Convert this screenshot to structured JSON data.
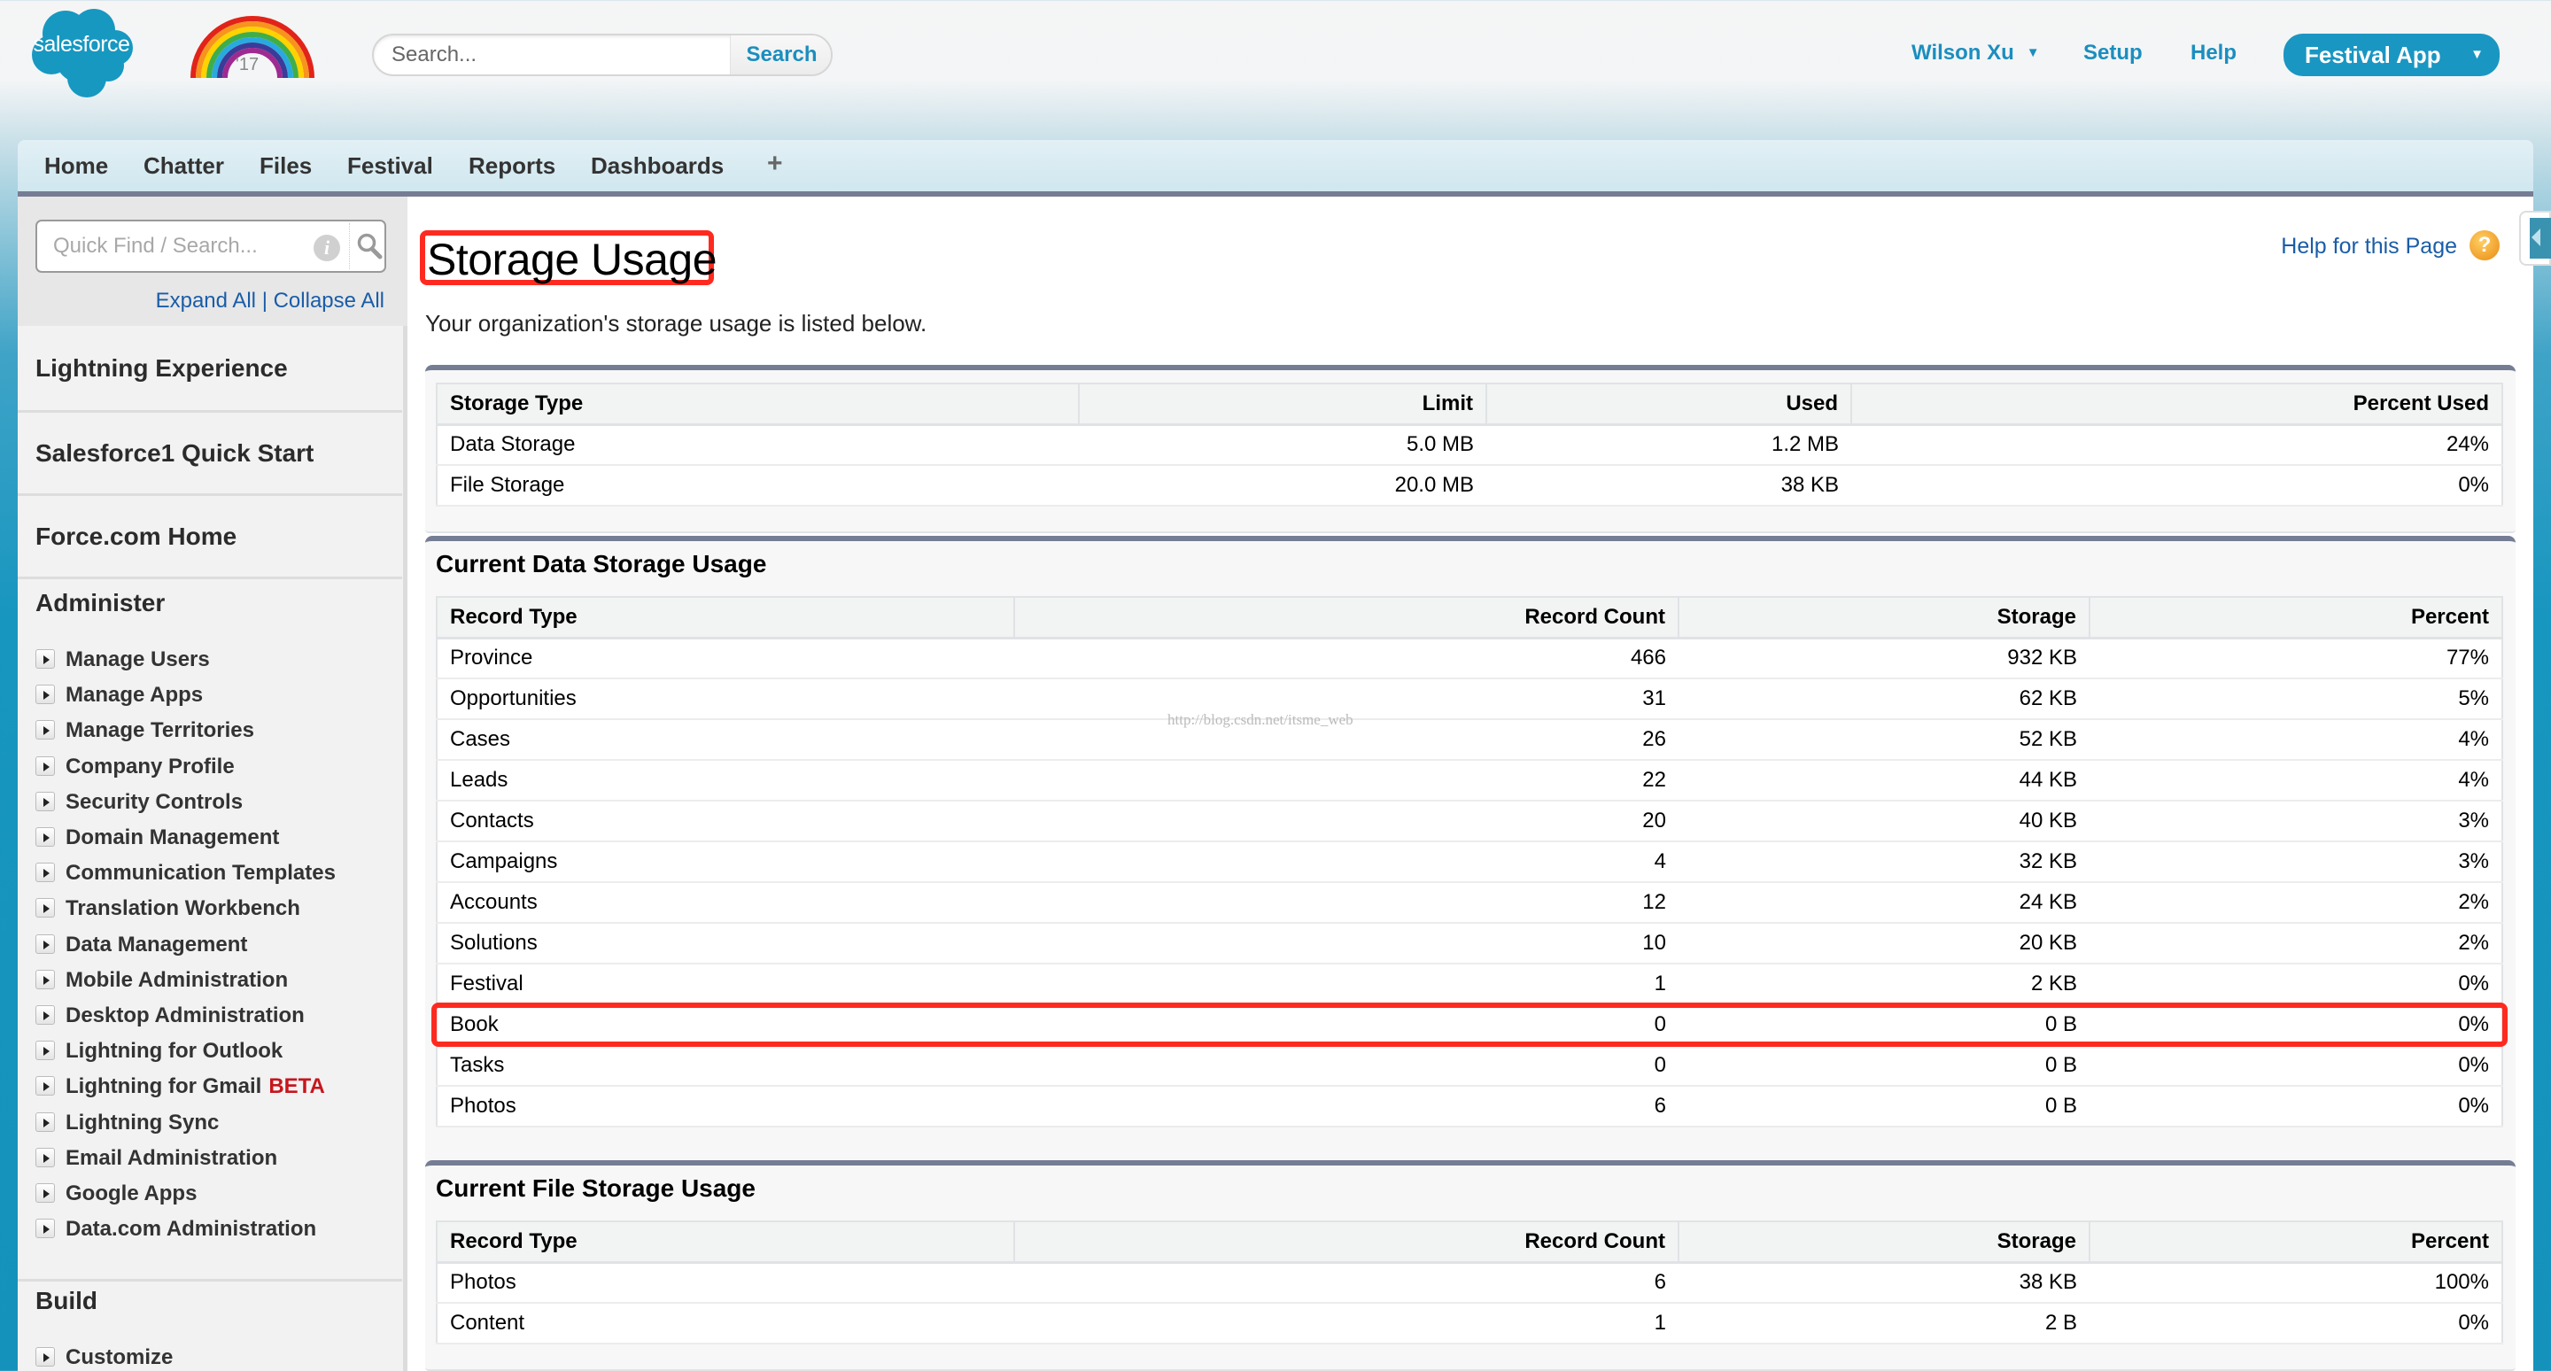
{
  "header": {
    "brand": "salesforce",
    "badge_year": "'17",
    "search": {
      "placeholder": "Search...",
      "button_label": "Search"
    },
    "user_menu_label": "Wilson Xu",
    "setup_label": "Setup",
    "help_label": "Help",
    "app_menu_label": "Festival App",
    "accent_color": "#1a96c2"
  },
  "tabs": [
    "Home",
    "Chatter",
    "Files",
    "Festival",
    "Reports",
    "Dashboards"
  ],
  "tab_add_icon": "+",
  "sidebar": {
    "quick_find_placeholder": "Quick Find / Search...",
    "expand_all": "Expand All",
    "separator": "|",
    "collapse_all": "Collapse All",
    "sections": [
      "Lightning Experience",
      "Salesforce1 Quick Start",
      "Force.com Home"
    ],
    "administer_title": "Administer",
    "administer_items": [
      "Manage Users",
      "Manage Apps",
      "Manage Territories",
      "Company Profile",
      "Security Controls",
      "Domain Management",
      "Communication Templates",
      "Translation Workbench",
      "Data Management",
      "Mobile Administration",
      "Desktop Administration",
      "Lightning for Outlook",
      "Lightning for Gmail",
      "Lightning Sync",
      "Email Administration",
      "Google Apps",
      "Data.com Administration"
    ],
    "beta_label": "BETA",
    "build_title": "Build",
    "build_items": [
      "Customize"
    ]
  },
  "main": {
    "title": "Storage Usage",
    "description": "Your organization's storage usage is listed below.",
    "help_link": "Help for this Page",
    "watermark": "http://blog.csdn.net/itsme_web",
    "summary_table": {
      "headers": [
        "Storage Type",
        "Limit",
        "Used",
        "Percent Used"
      ],
      "rows": [
        [
          "Data Storage",
          "5.0 MB",
          "1.2 MB",
          "24%"
        ],
        [
          "File Storage",
          "20.0 MB",
          "38 KB",
          "0%"
        ]
      ]
    },
    "data_storage": {
      "title": "Current Data Storage Usage",
      "headers": [
        "Record Type",
        "Record Count",
        "Storage",
        "Percent"
      ],
      "rows": [
        [
          "Province",
          "466",
          "932 KB",
          "77%"
        ],
        [
          "Opportunities",
          "31",
          "62 KB",
          "5%"
        ],
        [
          "Cases",
          "26",
          "52 KB",
          "4%"
        ],
        [
          "Leads",
          "22",
          "44 KB",
          "4%"
        ],
        [
          "Contacts",
          "20",
          "40 KB",
          "3%"
        ],
        [
          "Campaigns",
          "4",
          "32 KB",
          "3%"
        ],
        [
          "Accounts",
          "12",
          "24 KB",
          "2%"
        ],
        [
          "Solutions",
          "10",
          "20 KB",
          "2%"
        ],
        [
          "Festival",
          "1",
          "2 KB",
          "0%"
        ],
        [
          "Book",
          "0",
          "0 B",
          "0%"
        ],
        [
          "Tasks",
          "0",
          "0 B",
          "0%"
        ],
        [
          "Photos",
          "6",
          "0 B",
          "0%"
        ]
      ],
      "highlighted_row": "Book"
    },
    "file_storage": {
      "title": "Current File Storage Usage",
      "headers": [
        "Record Type",
        "Record Count",
        "Storage",
        "Percent"
      ],
      "rows": [
        [
          "Photos",
          "6",
          "38 KB",
          "100%"
        ],
        [
          "Content",
          "1",
          "2 B",
          "0%"
        ]
      ]
    }
  }
}
